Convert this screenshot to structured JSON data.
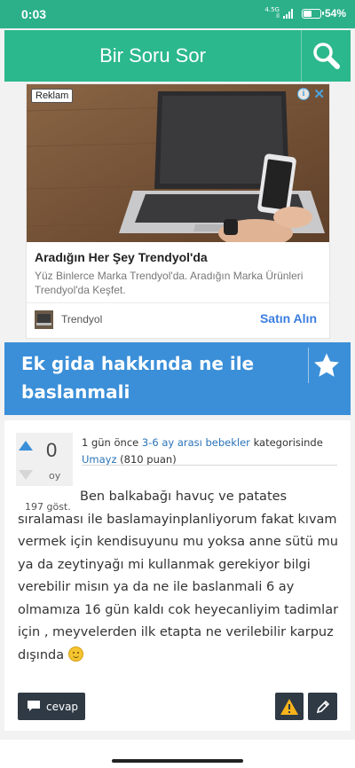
{
  "status_bar": {
    "time": "0:03",
    "network_top": "4.5G",
    "network_bottom": "il",
    "battery_percent": "54%",
    "battery_level": 0.54
  },
  "app_bar": {
    "title": "Bir Soru Sor",
    "search_icon": "search-icon"
  },
  "ad": {
    "badge": "Reklam",
    "info_icon": "info-icon",
    "close_icon": "close-icon",
    "close_glyph": "✕",
    "headline": "Aradığın Her Şey Trendyol'da",
    "description": "Yüz Binlerce Marka Trendyol'da. Aradığın Marka Ürünleri Trendyol'da Keşfet.",
    "brand": "Trendyol",
    "cta": "Satın Alın"
  },
  "question": {
    "title": "Ek gida hakkında ne ile baslanmali",
    "star_icon": "star-icon",
    "votes": "0",
    "votes_label": "oy",
    "views": "197 göst.",
    "meta_time": "1 gün önce",
    "meta_category": "3-6 ay arası bebekler",
    "meta_category_suffix": "kategorisinde",
    "meta_user": "Umayz",
    "meta_points": "(810 puan)",
    "body": "Ben balkabağı havuç ve patates sıralaması ile baslamayinplanliyorum fakat kıvam vermek için kendisuyunu mu yoksa anne sütü mu ya da zeytinyağı mi kullanmak gerekiyor bilgi verebilir misın ya da ne ile baslanmali 6 ay olmamıza 16 gün kaldı cok heyecanliyim tadimlar için , meyvelerden ilk etapta ne verilebilir karpuz dışında",
    "body_emoji": "smiley-emoji"
  },
  "actions": {
    "answer_label": "cevap",
    "answer_icon": "comment-icon",
    "flag_icon": "warning-icon",
    "edit_icon": "pencil-icon"
  },
  "colors": {
    "primary_green": "#2bb88c",
    "question_blue": "#3b8fd8",
    "button_dark": "#2f3a45",
    "link_blue": "#2a73b8"
  }
}
